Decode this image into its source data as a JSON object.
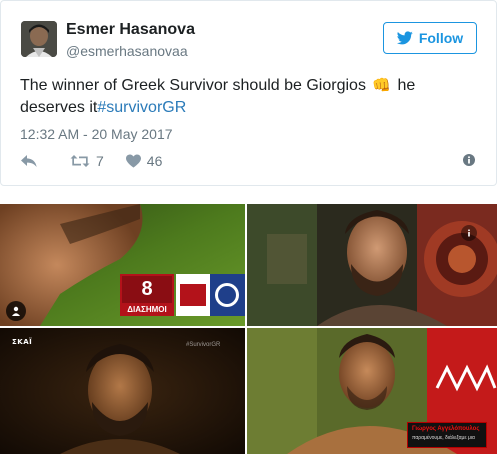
{
  "tweet": {
    "author_name": "Esmer Hasanova",
    "author_handle": "@esmerhasanovaa",
    "follow_label": "Follow",
    "text_before": "The winner of Greek Survivor should be Giorgios",
    "emoji": "👊",
    "text_after": "he deserves it",
    "hashtag": "#survivorGR",
    "timestamp": "12:32 AM - 20 May 2017",
    "retweet_count": "7",
    "like_count": "46",
    "icons": [
      "twitter-bird-icon",
      "reply-icon",
      "retweet-icon",
      "heart-icon",
      "info-icon"
    ],
    "accent_color": "#1b95e0",
    "hashtag_color": "#2b7bb9"
  },
  "media": {
    "photo_1": {
      "score": "8",
      "score_label": "ΔΙΑΣΗΜΟΙ"
    },
    "photo_3": {
      "channel": "ΣΚΑΪ",
      "tag": "#SurvivorGR"
    },
    "photo_4": {
      "caption_name": "Γιώργος Αγγελόπουλος",
      "caption_sub": "παραμένουμε, διάλεξαμε μια"
    }
  }
}
